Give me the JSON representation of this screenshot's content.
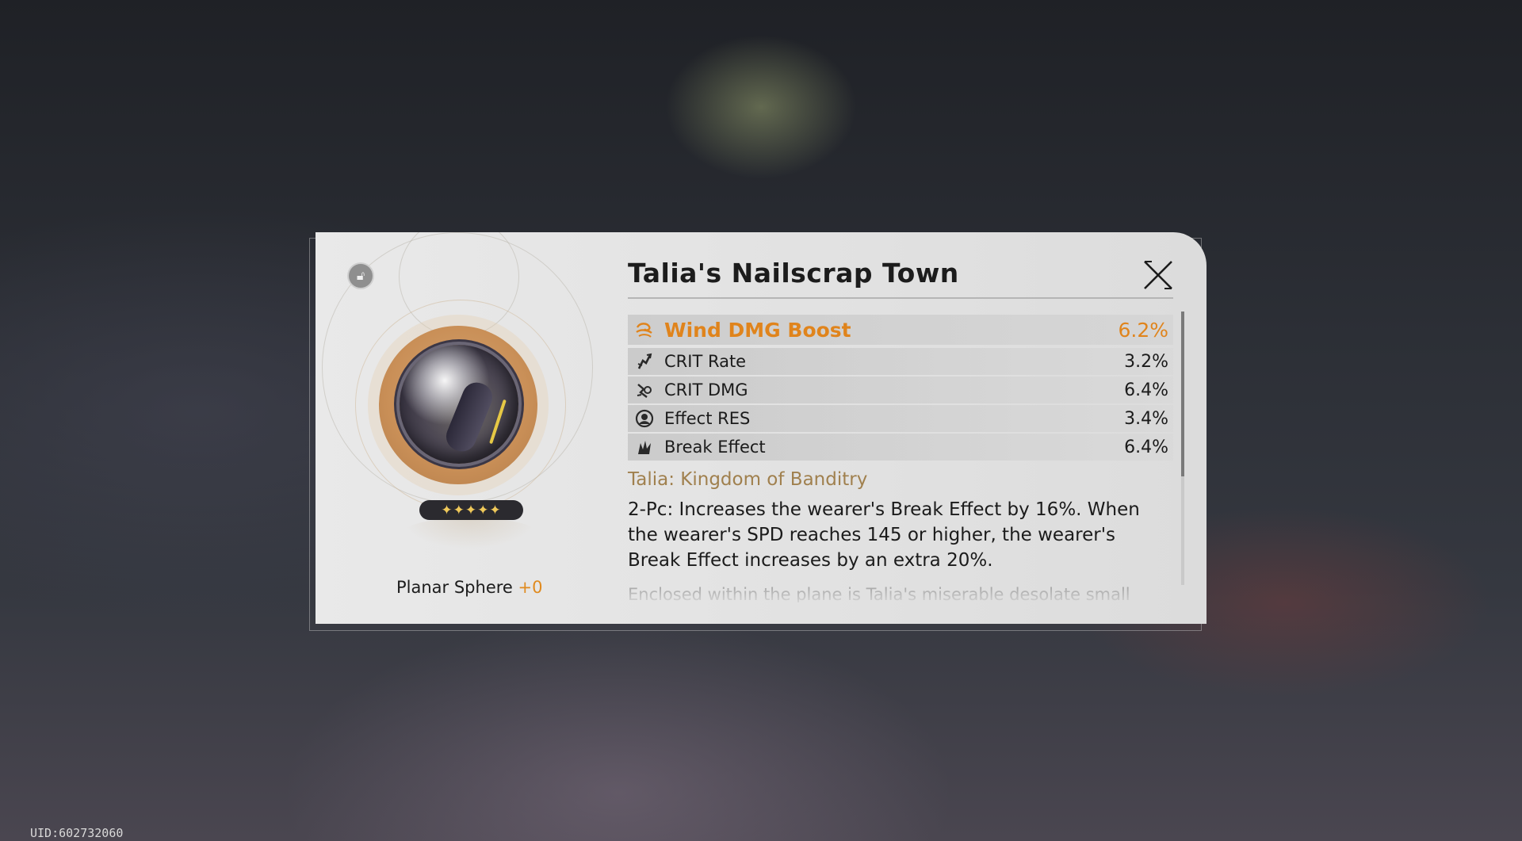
{
  "item": {
    "name": "Talia's Nailscrap Town",
    "slot": "Planar Sphere",
    "level": "+0",
    "rarity_stars": "✦✦✦✦✦"
  },
  "main_stat": {
    "name": "Wind DMG Boost",
    "value": "6.2%",
    "icon": "wind-icon"
  },
  "sub_stats": [
    {
      "name": "CRIT Rate",
      "value": "3.2%",
      "icon": "crit-rate-icon"
    },
    {
      "name": "CRIT DMG",
      "value": "6.4%",
      "icon": "crit-dmg-icon"
    },
    {
      "name": "Effect RES",
      "value": "3.4%",
      "icon": "effect-res-icon"
    },
    {
      "name": "Break Effect",
      "value": "6.4%",
      "icon": "break-effect-icon"
    }
  ],
  "set": {
    "name": "Talia: Kingdom of Banditry",
    "description": "2-Pc: Increases the wearer's Break Effect by 16%. When the wearer's SPD reaches 145 or higher, the wearer's Break Effect increases by an extra 20%.",
    "flavor": "Enclosed within the plane is Talia's miserable desolate small"
  },
  "footer": {
    "uid": "UID:602732060"
  },
  "colors": {
    "accent": "#e0841c",
    "set_name": "#a0804e",
    "panel": "#e6e6e6"
  }
}
